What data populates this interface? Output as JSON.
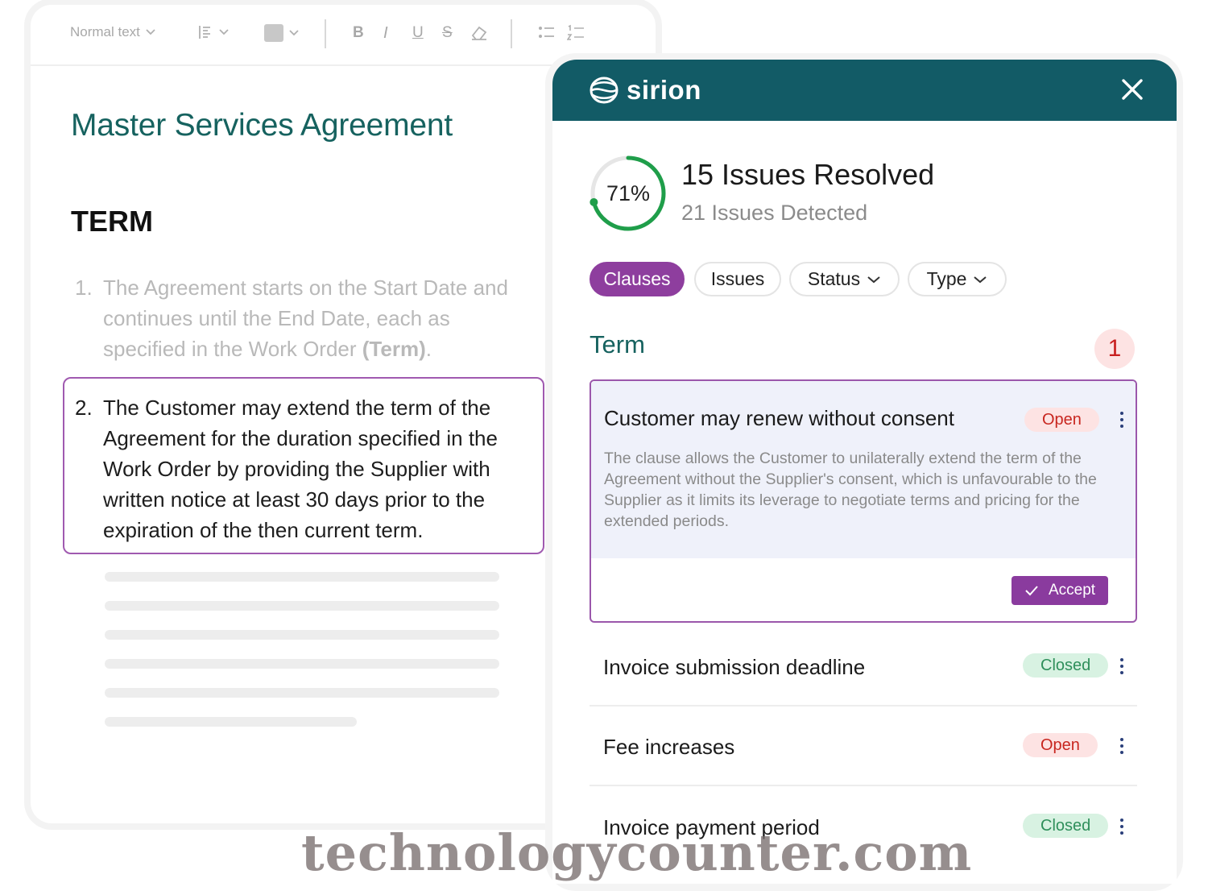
{
  "editor": {
    "toolbar": {
      "text_style": "Normal text",
      "bold": "B",
      "italic": "I",
      "underline": "U",
      "strike": "S"
    },
    "title": "Master Services Agreement",
    "heading": "TERM",
    "clauses": [
      {
        "number": "1.",
        "text": "The Agreement starts on the Start Date and continues until the End Date, each as specified in the Work Order ",
        "term": "(Term)",
        "suffix": "."
      },
      {
        "number": "2.",
        "text": "The Customer may extend the term of the Agreement for the duration specified in the Work Order by providing the Supplier with written notice at least 30 days prior to the expiration of the then current term."
      }
    ]
  },
  "panel": {
    "brand": "sirion",
    "colors": {
      "header": "#125b66",
      "accent": "#8e3e9e",
      "progress": "#1f9e4a"
    },
    "progress": {
      "percent": 71,
      "label": "71%"
    },
    "resolved": "15 Issues Resolved",
    "detected": "21 Issues Detected",
    "filters": [
      {
        "label": "Clauses",
        "active": true
      },
      {
        "label": "Issues",
        "active": false
      },
      {
        "label": "Status",
        "active": false,
        "dropdown": true
      },
      {
        "label": "Type",
        "active": false,
        "dropdown": true
      }
    ],
    "section": {
      "title": "Term",
      "count": "1"
    },
    "active_issue": {
      "title": "Customer may renew without consent",
      "status": "Open",
      "description": "The clause allows the Customer to unilaterally extend the term of the Agreement without the Supplier's consent, which is unfavourable to the Supplier as it limits its leverage to negotiate terms and pricing for the extended periods.",
      "action": "Accept"
    },
    "issues": [
      {
        "title": "Invoice submission deadline",
        "status": "Closed"
      },
      {
        "title": "Fee increases",
        "status": "Open"
      },
      {
        "title": "Invoice payment period",
        "status": "Closed"
      }
    ]
  },
  "watermark": "technologycounter.com"
}
